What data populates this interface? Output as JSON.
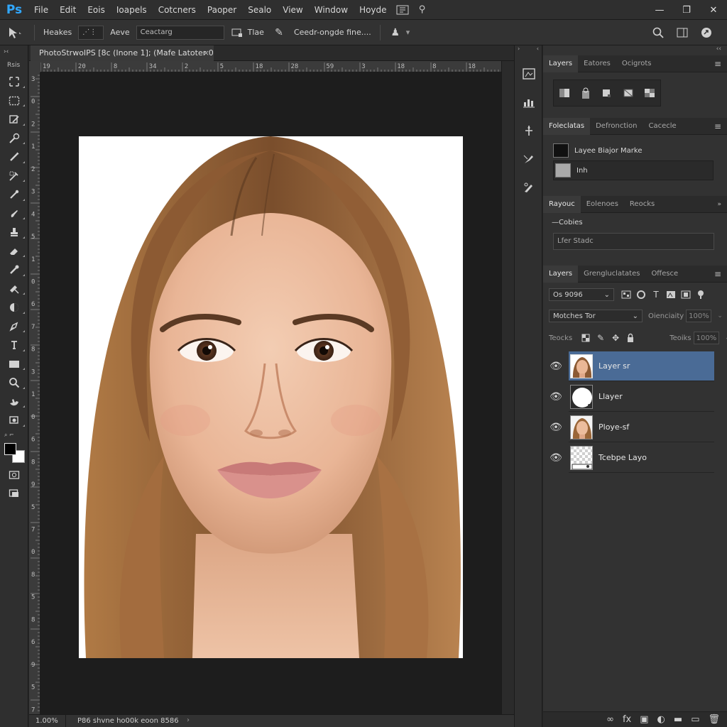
{
  "app": {
    "logo": "Ps"
  },
  "menu": [
    "File",
    "Edit",
    "Eois",
    "Ioapels",
    "Cotcners",
    "Paoper",
    "Sealo",
    "View",
    "Window",
    "Hoyde"
  ],
  "window_controls": {
    "minimize": "—",
    "restore": "❐",
    "close": "✕"
  },
  "options": {
    "preset_label": "Heakes",
    "field1": "⋰⋮",
    "mode_label": "Aeve",
    "search_value": "Ceactarg",
    "field2_label": "Tlae",
    "style_text": "Ceedr-ongde fine....",
    "more_label": "▾"
  },
  "toolbar": {
    "head": "Rsis",
    "sub_label": "⌕ ⌐"
  },
  "document": {
    "tab_title": "PhotoStrwoIPS  [8c (Inone 1]; (Mafe Latoter 0)",
    "tab_close": "×",
    "zoom": "1.00%",
    "status_info": "P86 shvne ho00k eoon 8586",
    "status_arrow": "›",
    "ruler_top_nums": [
      "19",
      "20",
      "8",
      "34",
      "2",
      "5",
      "18",
      "28",
      "59",
      "3",
      "18",
      "8",
      "18"
    ],
    "ruler_left_nums": [
      "3",
      "0",
      "2",
      "1",
      "2",
      "3",
      "4",
      "5",
      "1",
      "0",
      "6",
      "7",
      "8",
      "3",
      "1",
      "0",
      "6",
      "8",
      "9",
      "5",
      "7",
      "0",
      "8",
      "5",
      "8",
      "6",
      "9",
      "5",
      "7"
    ]
  },
  "panels": {
    "group1": {
      "tabs": [
        "Layers",
        "Eatores",
        "Ocigrots"
      ],
      "active": 0
    },
    "group2": {
      "tabs": [
        "Foleclatas",
        "Defronction",
        "Cacecle"
      ],
      "active": 0,
      "rows": [
        {
          "label": "Layee Biajor Marke"
        },
        {
          "label": "Inh"
        }
      ]
    },
    "group3": {
      "tabs": [
        "Rayouc",
        "Eolenoes",
        "Reocks"
      ],
      "active": 0,
      "section_title": "—Cobies",
      "field_value": "Lfer Stadc"
    },
    "layers": {
      "tabs": [
        "Layers",
        "Grengluclatates",
        "Offesce"
      ],
      "active": 0,
      "kind_value": "Os 9096",
      "blend_value": "Motches Tor",
      "opacity_label": "Oienciaity",
      "opacity_value": "100%",
      "lock_label": "Teocks",
      "fill_label": "Teoiks",
      "fill_value": "100%",
      "items": [
        {
          "name": "Layer sr",
          "selected": true,
          "thumb": "portrait"
        },
        {
          "name": "Llayer",
          "selected": false,
          "thumb": "mask"
        },
        {
          "name": "Ploye-sf",
          "selected": false,
          "thumb": "portrait"
        },
        {
          "name": "Tcebpe Layo",
          "selected": false,
          "thumb": "transparent"
        }
      ]
    }
  },
  "colors": {
    "accent": "#31a8ff",
    "selected_layer": "#4a6b96",
    "panel_bg": "#323232",
    "canvas_bg": "#1d1d1d"
  }
}
